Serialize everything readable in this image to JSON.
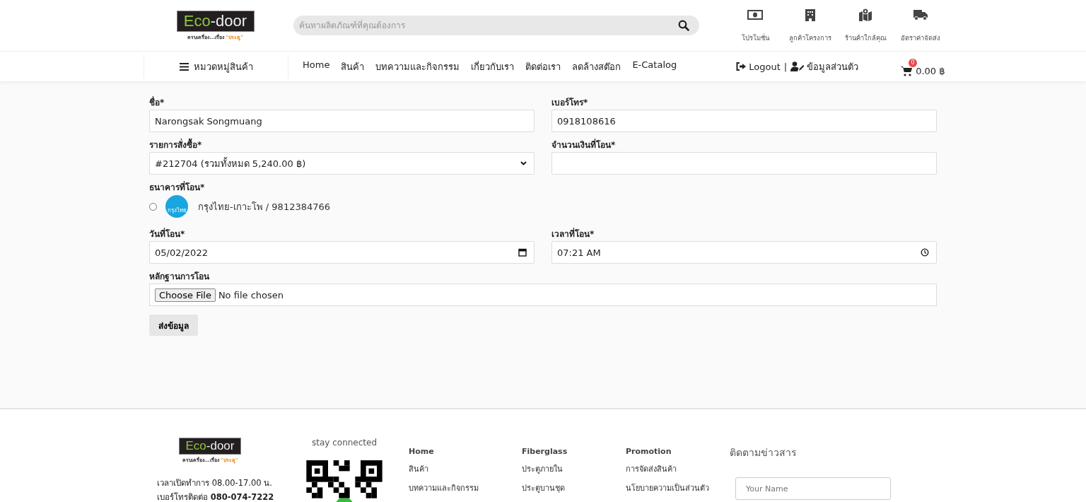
{
  "header": {
    "logo": {
      "word_a": "Eco",
      "word_b": "-door",
      "tagline_a": "ครบเครื่อง...เรื่อง",
      "tagline_b": "\"ประตู\""
    },
    "search": {
      "placeholder": "ค้นหาผลิตภัณฑ์ที่คุณต้องการ"
    },
    "quick_links": [
      {
        "kind": "money",
        "label": "โปรโมชั่น"
      },
      {
        "kind": "building",
        "label": "ลูกค้าโครงการ"
      },
      {
        "kind": "map",
        "label": "ร้านค้าใกล้คุณ"
      },
      {
        "kind": "truck",
        "label": "อัตราค่าจัดส่ง"
      }
    ]
  },
  "nav": {
    "category_label": "หมวดหมู่สินค้า",
    "items": [
      "Home",
      "สินค้า",
      "บทความและกิจกรรม",
      "เกี่ยวกับเรา",
      "ติดต่อเรา",
      "ลดล้างสต๊อก",
      "E-Catalog"
    ],
    "logout": "Logout",
    "separator": "|",
    "profile": "ข้อมูลส่วนตัว",
    "cart_count": "0",
    "cart_total": "0.00 ฿"
  },
  "form": {
    "name": {
      "label": "ชื่อ*",
      "value": "Narongsak Songmuang"
    },
    "phone": {
      "label": "เบอร์โทร*",
      "value": "0918108616"
    },
    "order": {
      "label": "รายการสั่งซื้อ*",
      "value": "#212704 (รวมทั้งหมด 5,240.00 ฿)"
    },
    "amount": {
      "label": "จำนวนเงินที่โอน*"
    },
    "bank": {
      "label": "ธนาคารที่โอน*",
      "options": [
        {
          "logo_text": "กรุงไทย",
          "label": "กรุงไทย-เกาะโพ / 9812384766",
          "selected": false
        }
      ]
    },
    "date": {
      "label": "วันที่โอน*",
      "value": "05/02/2022"
    },
    "time": {
      "label": "เวลาที่โอน*",
      "value": "07:21 AM"
    },
    "proof": {
      "label": "หลักฐานการโอน",
      "button": "Choose File",
      "status": "No file chosen"
    },
    "submit": "ส่งข้อมูล"
  },
  "footer": {
    "logo": {
      "word_a": "Eco",
      "word_b": "-door",
      "tagline_a": "ครบเครื่อง...เรื่อง",
      "tagline_b": "\"ประตู\""
    },
    "hours": "เวลาเปิดทำการ 08.00-17.00 น.",
    "phone_label": "เบอร์โทรติดต่อ",
    "phone": "080-074-7222",
    "stay_connected": "stay connected",
    "columns": [
      {
        "links": [
          "Home",
          "สินค้า",
          "บทความและกิจกรรม"
        ]
      },
      {
        "links": [
          "Fiberglass",
          "ประตูภายใน",
          "ประตูบานชุด"
        ]
      },
      {
        "links": [
          "Promotion",
          "การจัดส่งสินค้า",
          "นโยบายความเป็นส่วนตัว"
        ]
      }
    ],
    "newsletter": {
      "title": "ติดตามข่าวสาร",
      "name_placeholder": "Your Name"
    }
  }
}
